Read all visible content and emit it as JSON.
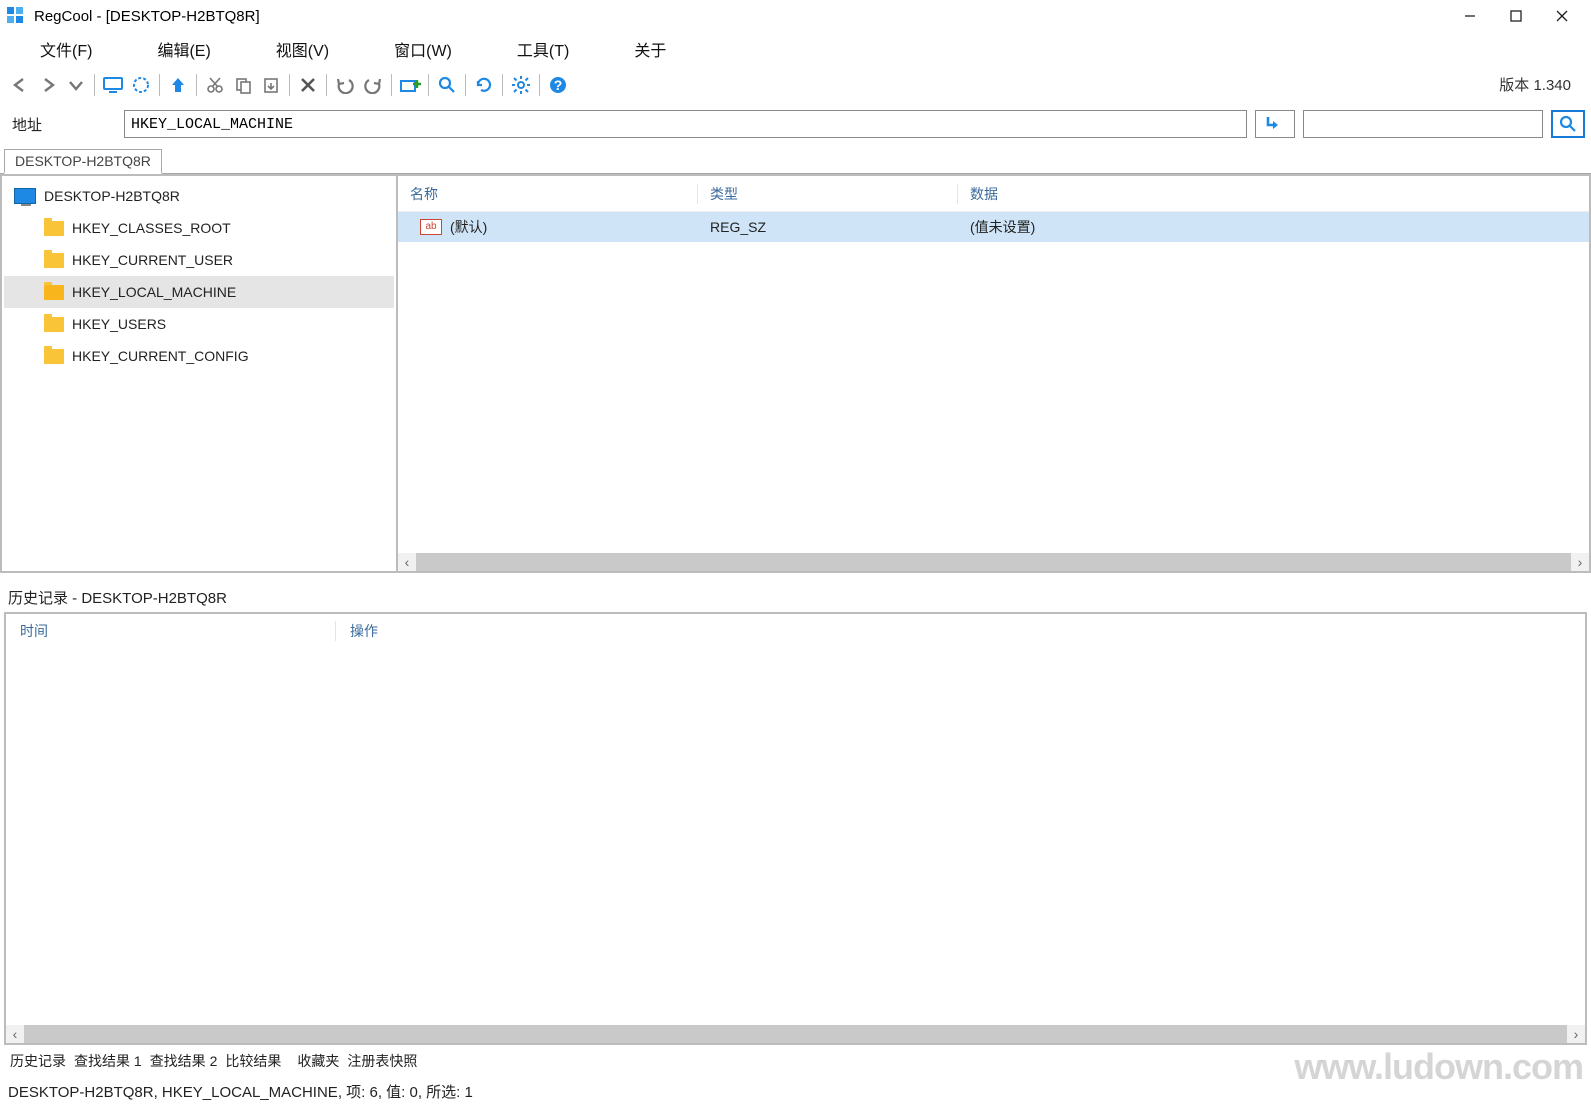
{
  "window": {
    "title": "RegCool - [DESKTOP-H2BTQ8R]"
  },
  "menu": {
    "file": "文件(F)",
    "edit": "编辑(E)",
    "view": "视图(V)",
    "window": "窗口(W)",
    "tools": "工具(T)",
    "about": "关于"
  },
  "toolbar": {
    "version": "版本 1.340"
  },
  "address_bar": {
    "label": "地址",
    "value": "HKEY_LOCAL_MACHINE",
    "search_value": ""
  },
  "breadcrumb": {
    "tab": "DESKTOP-H2BTQ8R"
  },
  "tree": {
    "root": "DESKTOP-H2BTQ8R",
    "items": [
      "HKEY_CLASSES_ROOT",
      "HKEY_CURRENT_USER",
      "HKEY_LOCAL_MACHINE",
      "HKEY_USERS",
      "HKEY_CURRENT_CONFIG"
    ],
    "selected_index": 2
  },
  "values": {
    "columns": {
      "name": "名称",
      "type": "类型",
      "data": "数据"
    },
    "rows": [
      {
        "name": "(默认)",
        "type": "REG_SZ",
        "data": "(值未设置)"
      }
    ]
  },
  "history": {
    "title": "历史记录 - DESKTOP-H2BTQ8R",
    "columns": {
      "time": "时间",
      "op": "操作"
    }
  },
  "bottom_tabs": {
    "t0": "历史记录",
    "t1": "查找结果 1",
    "t2": "查找结果 2",
    "t3": "比较结果",
    "t4": "收藏夹",
    "t5": "注册表快照"
  },
  "statusbar": {
    "text": "DESKTOP-H2BTQ8R, HKEY_LOCAL_MACHINE, 项: 6, 值: 0, 所选: 1"
  },
  "watermark": "www.ludown.com"
}
